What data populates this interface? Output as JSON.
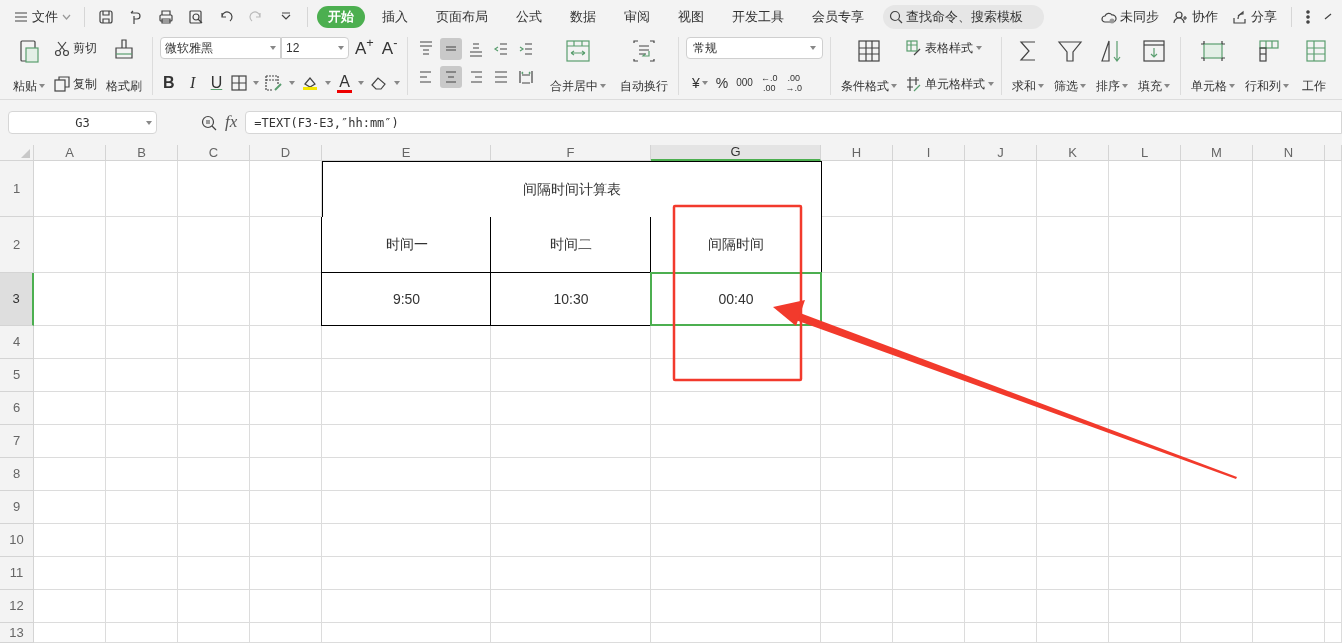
{
  "menu": {
    "file": "文件",
    "tabs": [
      {
        "label": "开始",
        "selected": true
      },
      {
        "label": "插入",
        "selected": false
      },
      {
        "label": "页面布局",
        "selected": false
      },
      {
        "label": "公式",
        "selected": false
      },
      {
        "label": "数据",
        "selected": false
      },
      {
        "label": "审阅",
        "selected": false
      },
      {
        "label": "视图",
        "selected": false
      },
      {
        "label": "开发工具",
        "selected": false
      },
      {
        "label": "会员专享",
        "selected": false
      }
    ],
    "search": {
      "placeholder": "查找命令、搜索模板"
    },
    "sync": "未同步",
    "collaborate": "协作",
    "share": "分享"
  },
  "ribbon": {
    "paste": "粘贴",
    "cut": "剪切",
    "copy": "复制",
    "format_painter": "格式刷",
    "font_name": "微软雅黑",
    "font_size": "12",
    "grow_font": "A$^{+}$",
    "shrink_font": "A$^{-}$",
    "bold": "B",
    "italic": "I",
    "underline": "U",
    "font_color": "A",
    "align_buttons": [
      {
        "selected": false
      },
      {
        "selected": true
      },
      {
        "selected": false
      },
      {
        "selected": false
      },
      {
        "selected": false
      },
      {
        "selected": false
      },
      {
        "selected": true
      },
      {
        "selected": false
      },
      {
        "selected": false
      },
      {
        "selected": false
      }
    ],
    "merge": "合并居中",
    "wrap": "自动换行",
    "number_format": "常规",
    "currency": "¥",
    "percent": "%",
    "thousands": "000",
    "decimals": [
      {
        "top": "←.0",
        "bottom": ".00"
      },
      {
        "top": ".00",
        "bottom": "→.0"
      }
    ],
    "conditional_format": "条件格式",
    "table_style": "表格样式",
    "cell_style": "单元格样式",
    "sum": "求和",
    "filter": "筛选",
    "sort": "排序",
    "fill": "填充",
    "cell": "单元格",
    "rows_columns": "行和列",
    "worksheet": "工作"
  },
  "formula_bar": {
    "name_box": "G3",
    "fx": "fx",
    "formula": "=TEXT(F3-E3,″hh:mm″)"
  },
  "sheet": {
    "columns": [
      {
        "label": "A",
        "selected": false
      },
      {
        "label": "B",
        "selected": false
      },
      {
        "label": "C",
        "selected": false
      },
      {
        "label": "D",
        "selected": false
      },
      {
        "label": "E",
        "selected": false
      },
      {
        "label": "F",
        "selected": false
      },
      {
        "label": "G",
        "selected": true
      },
      {
        "label": "H",
        "selected": false
      },
      {
        "label": "I",
        "selected": false
      },
      {
        "label": "J",
        "selected": false
      },
      {
        "label": "K",
        "selected": false
      },
      {
        "label": "L",
        "selected": false
      },
      {
        "label": "M",
        "selected": false
      },
      {
        "label": "N",
        "selected": false
      }
    ],
    "rows": [
      {
        "label": "1",
        "selected": false
      },
      {
        "label": "2",
        "selected": false
      },
      {
        "label": "3",
        "selected": true
      },
      {
        "label": "4",
        "selected": false
      },
      {
        "label": "5",
        "selected": false
      },
      {
        "label": "6",
        "selected": false
      },
      {
        "label": "7",
        "selected": false
      },
      {
        "label": "8",
        "selected": false
      },
      {
        "label": "9",
        "selected": false
      },
      {
        "label": "10",
        "selected": false
      },
      {
        "label": "11",
        "selected": false
      },
      {
        "label": "12",
        "selected": false
      },
      {
        "label": "13",
        "selected": false
      }
    ],
    "table": {
      "title": "间隔时间计算表",
      "headers": [
        "时间一",
        "时间二",
        "间隔时间"
      ],
      "values": [
        {
          "text": "9:50",
          "selected": false
        },
        {
          "text": "10:30",
          "selected": false
        },
        {
          "text": "00:40",
          "selected": true
        }
      ]
    }
  }
}
